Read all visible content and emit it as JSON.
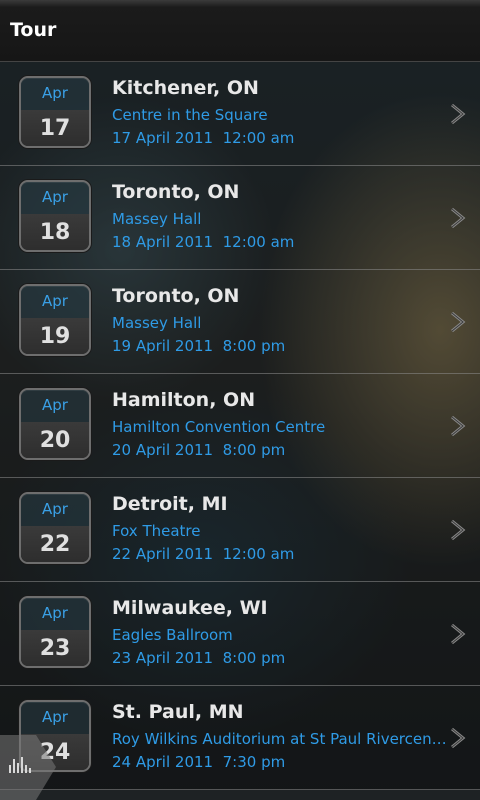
{
  "header": {
    "title": "Tour"
  },
  "events": [
    {
      "month": "Apr",
      "day": "17",
      "city": "Kitchener, ON",
      "venue": "Centre in the Square",
      "datetime": "17 April 2011  12:00 am"
    },
    {
      "month": "Apr",
      "day": "18",
      "city": "Toronto, ON",
      "venue": "Massey Hall",
      "datetime": "18 April 2011  12:00 am"
    },
    {
      "month": "Apr",
      "day": "19",
      "city": "Toronto, ON",
      "venue": "Massey Hall",
      "datetime": "19 April 2011  8:00 pm"
    },
    {
      "month": "Apr",
      "day": "20",
      "city": "Hamilton, ON",
      "venue": "Hamilton Convention Centre",
      "datetime": "20 April 2011  8:00 pm"
    },
    {
      "month": "Apr",
      "day": "22",
      "city": "Detroit, MI",
      "venue": "Fox Theatre",
      "datetime": "22 April 2011  12:00 am"
    },
    {
      "month": "Apr",
      "day": "23",
      "city": "Milwaukee, WI",
      "venue": "Eagles Ballroom",
      "datetime": "23 April 2011  8:00 pm"
    },
    {
      "month": "Apr",
      "day": "24",
      "city": "St. Paul, MN",
      "venue": "Roy Wilkins Auditorium at St Paul Rivercentre",
      "datetime": "24 April 2011  7:30 pm"
    }
  ],
  "icons": {
    "chevron": "chevron-right-icon",
    "equalizer": "equalizer-icon"
  },
  "colors": {
    "accent": "#2f9be6",
    "calendar_month": "#3aa0e6"
  }
}
